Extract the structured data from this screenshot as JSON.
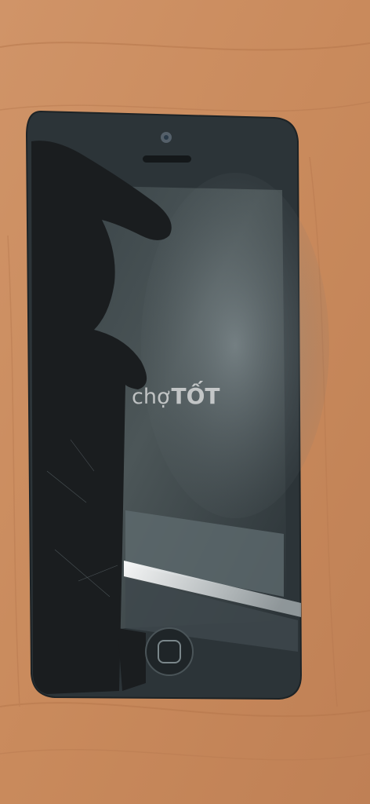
{
  "watermark": {
    "part1": "chợ",
    "part2": "TỐT"
  },
  "colors": {
    "table": "#c98a5a",
    "phone_body": "#2b3236",
    "screen": "#1e2428",
    "watermark": "#ebebeb"
  }
}
